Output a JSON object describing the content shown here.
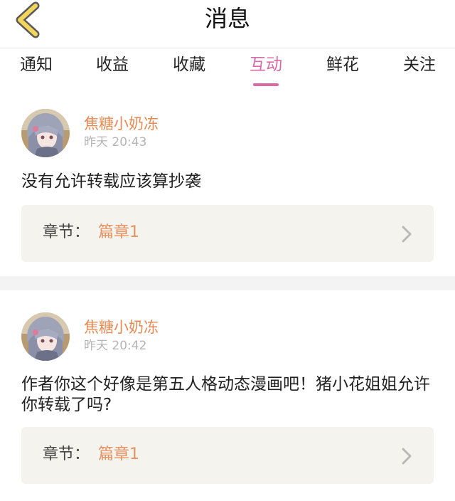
{
  "header": {
    "title": "消息",
    "back_icon": "chevron-left-icon",
    "back_color": "#f2d65c"
  },
  "tabs": [
    {
      "label": "通知",
      "active": false
    },
    {
      "label": "收益",
      "active": false
    },
    {
      "label": "收藏",
      "active": false
    },
    {
      "label": "互动",
      "active": true
    },
    {
      "label": "鲜花",
      "active": false
    },
    {
      "label": "关注",
      "active": false
    }
  ],
  "colors": {
    "accent": "#d96aa6",
    "username": "#e68a55",
    "chapter_link": "#e8915f",
    "chapter_bg": "#f4f3ee"
  },
  "messages": [
    {
      "username": "焦糖小奶冻",
      "time": "昨天 20:43",
      "comment": "没有允许转载应该算抄袭",
      "chapter_prefix": "章节：",
      "chapter_name": "篇章1"
    },
    {
      "username": "焦糖小奶冻",
      "time": "昨天 20:42",
      "comment": "作者你这个好像是第五人格动态漫画吧！猪小花姐姐允许你转载了吗?",
      "chapter_prefix": "章节：",
      "chapter_name": "篇章1"
    }
  ]
}
